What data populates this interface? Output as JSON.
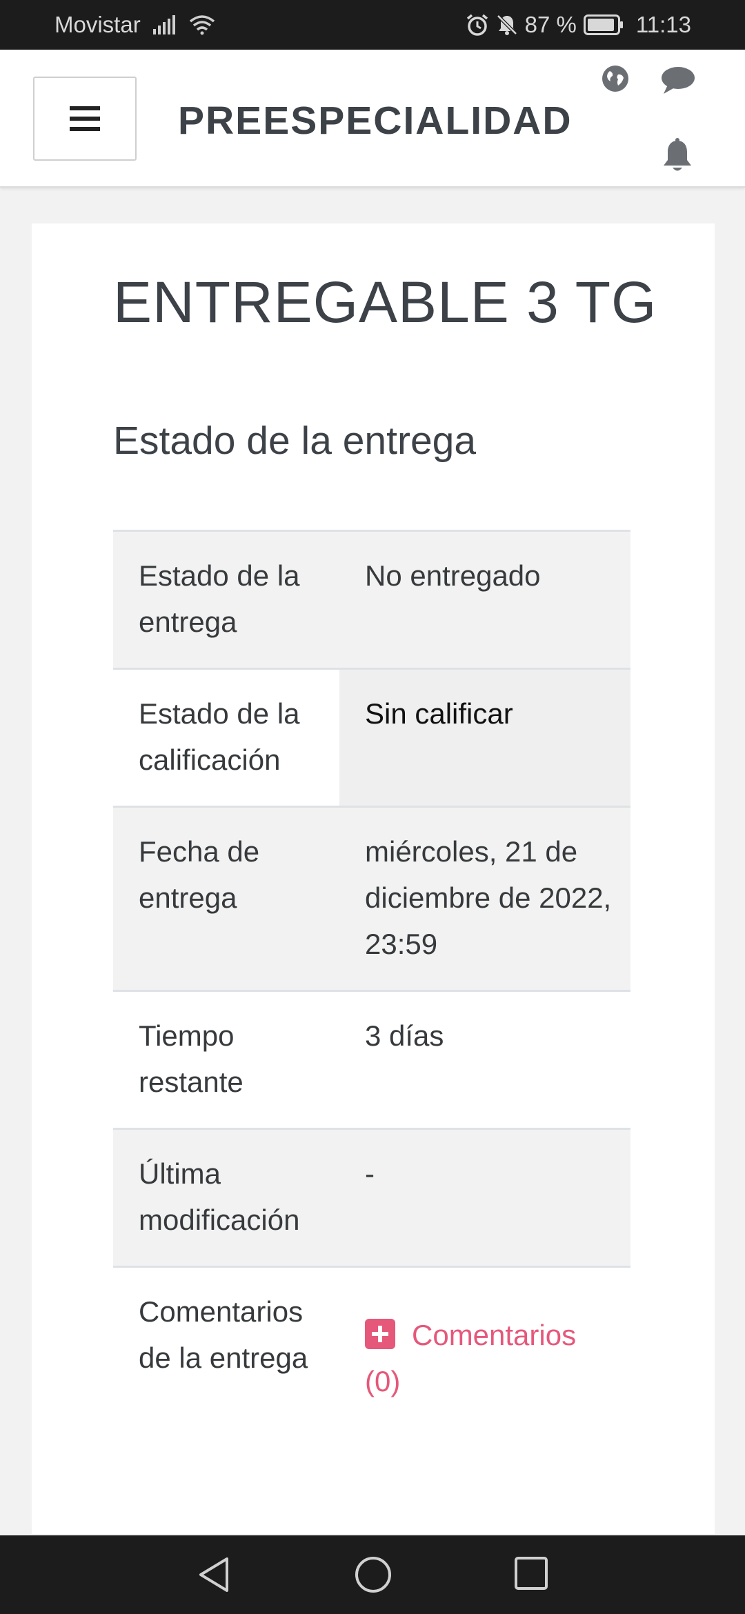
{
  "status_bar": {
    "carrier": "Movistar",
    "battery": "87 %",
    "time": "11:13",
    "icons": [
      "signal-icon",
      "wifi-icon",
      "alarm-icon",
      "bell-off-icon",
      "battery-icon"
    ]
  },
  "navbar": {
    "brand": "PREESPECIALIDAD",
    "icons": [
      "menu-icon",
      "globe-icon",
      "chat-icon",
      "bell-icon"
    ]
  },
  "page": {
    "title": "ENTREGABLE 3 TG",
    "section_title": "Estado de la entrega"
  },
  "table": {
    "rows": [
      {
        "label": "Estado de la entrega",
        "value": "No entregado"
      },
      {
        "label": "Estado de la calificación",
        "value": "Sin calificar"
      },
      {
        "label": "Fecha de entrega",
        "value": "miércoles, 21 de diciembre de 2022, 23:59"
      },
      {
        "label": "Tiempo restante",
        "value": "3 días"
      },
      {
        "label": "Última modificación",
        "value": "-"
      },
      {
        "label": "Comentarios de la entrega",
        "value": "Comentarios (0)"
      }
    ]
  },
  "colors": {
    "link": "#e5587a",
    "navbar_text": "#3d4248",
    "status_bar_bg": "#1c1c1c"
  },
  "bottom_nav": {
    "icons": [
      "back-icon",
      "home-icon",
      "recents-icon"
    ]
  }
}
